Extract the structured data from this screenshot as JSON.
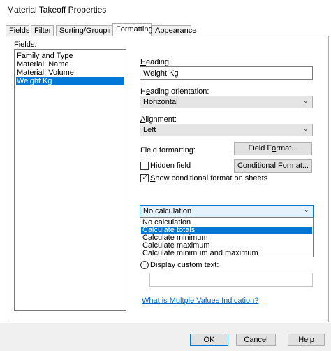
{
  "window": {
    "title": "Material Takeoff Properties"
  },
  "tabs": [
    {
      "label": "Fields"
    },
    {
      "label": "Filter"
    },
    {
      "label": "Sorting/Grouping"
    },
    {
      "label": "Formatting"
    },
    {
      "label": "Appearance"
    }
  ],
  "fields": {
    "label": "Fields:",
    "items": [
      "Family and Type",
      "Material: Name",
      "Material: Volume",
      "Weight Kg"
    ],
    "selected_index": 3
  },
  "heading": {
    "label": "Heading:",
    "value": "Weight Kg"
  },
  "heading_orientation": {
    "label": "Heading orientation:",
    "value": "Horizontal"
  },
  "alignment": {
    "label": "Alignment:",
    "value": "Left"
  },
  "field_formatting": {
    "label": "Field formatting:",
    "field_format_button": "Field Format...",
    "conditional_format_button": "Conditional Format..."
  },
  "hidden_field": {
    "label": "Hidden field",
    "checked": false
  },
  "show_conditional": {
    "label": "Show conditional format on sheets",
    "checked": true
  },
  "calculation": {
    "value": "No calculation",
    "options": [
      "No calculation",
      "Calculate totals",
      "Calculate minimum",
      "Calculate maximum",
      "Calculate minimum and maximum"
    ],
    "highlighted_index": 1
  },
  "display_custom_text": {
    "label": "Display custom text:",
    "value": ""
  },
  "help_link": "What is Multple Values Indication?",
  "footer": {
    "ok": "OK",
    "cancel": "Cancel",
    "help": "Help"
  }
}
